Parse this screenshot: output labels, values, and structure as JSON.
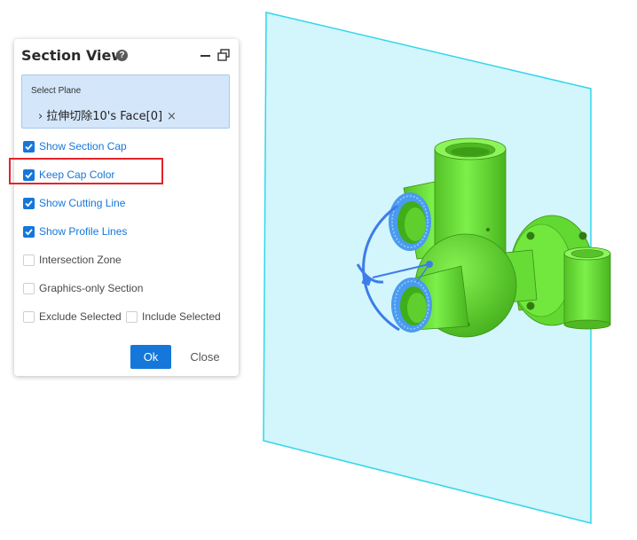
{
  "panel": {
    "title": "Section View",
    "help_icon": "?",
    "select_plane": {
      "label": "Select Plane",
      "item_text": "拉伸切除10's Face[0]",
      "chevron": "›",
      "remove": "×"
    },
    "options": {
      "show_section_cap": {
        "label": "Show Section Cap",
        "checked": true
      },
      "keep_cap_color": {
        "label": "Keep Cap Color",
        "checked": true
      },
      "show_cutting_line": {
        "label": "Show Cutting Line",
        "checked": true
      },
      "show_profile_lines": {
        "label": "Show Profile Lines",
        "checked": true
      },
      "intersection_zone": {
        "label": "Intersection Zone",
        "checked": false
      },
      "graphics_only_section": {
        "label": "Graphics-only Section",
        "checked": false
      },
      "exclude_selected": {
        "label": "Exclude Selected",
        "checked": false
      },
      "include_selected": {
        "label": "Include Selected",
        "checked": false
      }
    },
    "ok_label": "Ok",
    "close_label": "Close"
  },
  "colors": {
    "accent": "#1577d9",
    "highlight": "#e3242b",
    "model": "#6fe33a",
    "plane": "#c8f3fb",
    "select_bg": "#d4e6fa"
  },
  "icons": [
    "help-icon",
    "minimize-icon",
    "restore-icon",
    "chevron-right-icon",
    "remove-icon",
    "checkbox-checked-icon",
    "checkbox-unchecked-icon"
  ]
}
